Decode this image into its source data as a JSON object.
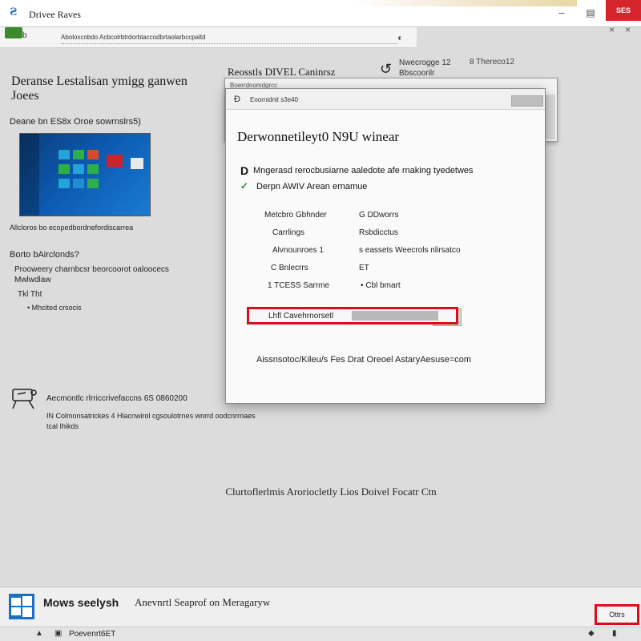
{
  "window": {
    "title": "Drivee Raves",
    "min_glyph": "–",
    "max_glyph": "▤",
    "close_label": "SES",
    "x_glyph": "×",
    "x2_glyph": "×"
  },
  "nav": {
    "back_text": "b",
    "address": "Aboloxcobdo Acbcolrbtrdorbtaccodbrtaolarbccpaltd",
    "go_glyph": "◐"
  },
  "left": {
    "title_line1": "Deranse Lestalisan ymigg ganwen",
    "title_line2": "Joees",
    "caption": "Deane bn ES8x Oroe sowrnslrs5)",
    "thumb_caption": "Allcloros bo ecopedbordnefordiscarrea",
    "section2_title": "Borto bAirclonds?",
    "section2_body": "Prooweery charnbcsr beorcoorot oaloocecs Mwlwdlaw",
    "tag": "Tkl  Tht",
    "bullet": "• Mhcited crsocis",
    "device_line1": "Aecmontlc rlrriccrivefaccns 6S 0860200",
    "device_line2": "IN Colmonsatrickes  4 Hlacnwirol cgsoulotrnes wnrrd oodcnrrnaes",
    "device_line3": "tcal Ihikds"
  },
  "right_header": {
    "title": "Reosstls DIVEL Caninrsz",
    "back_glyph": "↺",
    "text1": "Nwecrogge 12",
    "text2": "Bbscoorilr",
    "glyph": "8  Thereco12"
  },
  "back_window": {
    "title": "Boerrdnomdgrcc"
  },
  "dialog": {
    "head_icon": "Ð",
    "head_title": "Eoornidnit s3e40",
    "heading": "Derwonnetileyt0 N9U winear",
    "check_glyph": "D",
    "desc": "Mngerasd rerocbusiarne aaledote afe rnaking tyedetwes",
    "tick_glyph": "✓",
    "subtitle": "Derpn AWIV  Arean ernamue",
    "rows": [
      {
        "label": "Metcbro Gbhnder",
        "value": "G  DDworrs"
      },
      {
        "label": "Carrlings",
        "value": "Rsbdicctus"
      },
      {
        "label": "Alvnounroes 1",
        "value": "s  eassets Weecrols nlirsatco"
      },
      {
        "label": "C  Bnlecrrs",
        "value": "ET"
      },
      {
        "label": "1 TCESS Sarrme",
        "value": "•  Cbl bmart"
      }
    ],
    "field_value": "Lhfl Cavehrnorsetl",
    "footer": "Aissnsotoc/Kileu/s Fes Drat Oreoel AstaryAesuse=com"
  },
  "center_note": "Clurtoflerlmis Aroriocletly Lios Doivel Focatr Ctn",
  "bottom": {
    "app_name": "Mows seelysh",
    "desc": "Anevnrtl Seaprof on Meragaryw",
    "button": "Ottrs"
  },
  "status": {
    "icon1": "▲",
    "icon2": "▣",
    "text": "Poevenrt6ET",
    "icon3": "◆",
    "icon4": "▮"
  },
  "colors": {
    "accent_red": "#d6101b",
    "close_red": "#d6242d",
    "check_green": "#2d8a2d"
  }
}
